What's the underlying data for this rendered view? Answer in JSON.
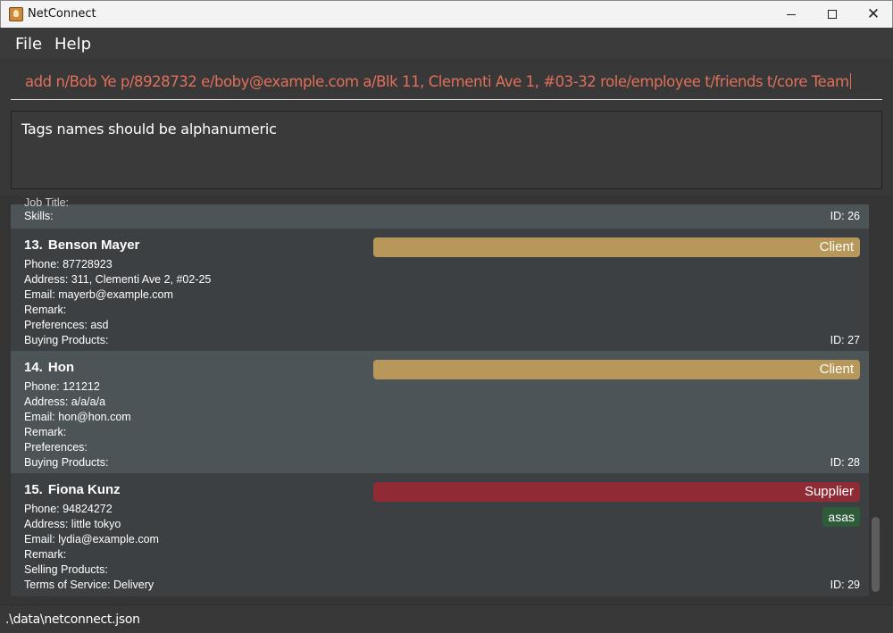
{
  "window": {
    "title": "NetConnect"
  },
  "menu": {
    "file": "File",
    "help": "Help"
  },
  "command": {
    "value": "add n/Bob Ye p/8928732 e/boby@example.com a/Blk 11, Clementi Ave 1, #03-32 role/employee t/friends t/core Team"
  },
  "result": {
    "message": "Tags names should be alphanumeric"
  },
  "cards": {
    "partial": {
      "skills_label": "Skills:",
      "id": "ID: 26",
      "cutoff_text": "Job Title:"
    },
    "c13": {
      "index": "13.",
      "name": "Benson Mayer",
      "role": "Client",
      "phone": "Phone: 87728923",
      "address": "Address: 311, Clementi Ave 2, #02-25",
      "email": "Email: mayerb@example.com",
      "remark": "Remark:",
      "preferences": "Preferences: asd",
      "products": "Buying Products:",
      "id": "ID: 27"
    },
    "c14": {
      "index": "14.",
      "name": "Hon",
      "role": "Client",
      "phone": "Phone: 121212",
      "address": "Address: a/a/a/a",
      "email": "Email: hon@hon.com",
      "remark": "Remark:",
      "preferences": "Preferences:",
      "products": "Buying Products:",
      "id": "ID: 28"
    },
    "c15": {
      "index": "15.",
      "name": "Fiona Kunz",
      "role": "Supplier",
      "tag": "asas",
      "phone": "Phone: 94824272",
      "address": "Address: little tokyo",
      "email": "Email: lydia@example.com",
      "remark": "Remark:",
      "products": "Selling Products:",
      "terms": "Terms of Service: Delivery",
      "id": "ID: 29"
    }
  },
  "status": {
    "path": ".\\data\\netconnect.json"
  },
  "colors": {
    "client": "#b8975a",
    "supplier": "#8e2b35",
    "tag": "#2e5b3a",
    "command_text": "#e0705a",
    "card_selected": "#4d5458",
    "card_default": "#3d4043"
  }
}
